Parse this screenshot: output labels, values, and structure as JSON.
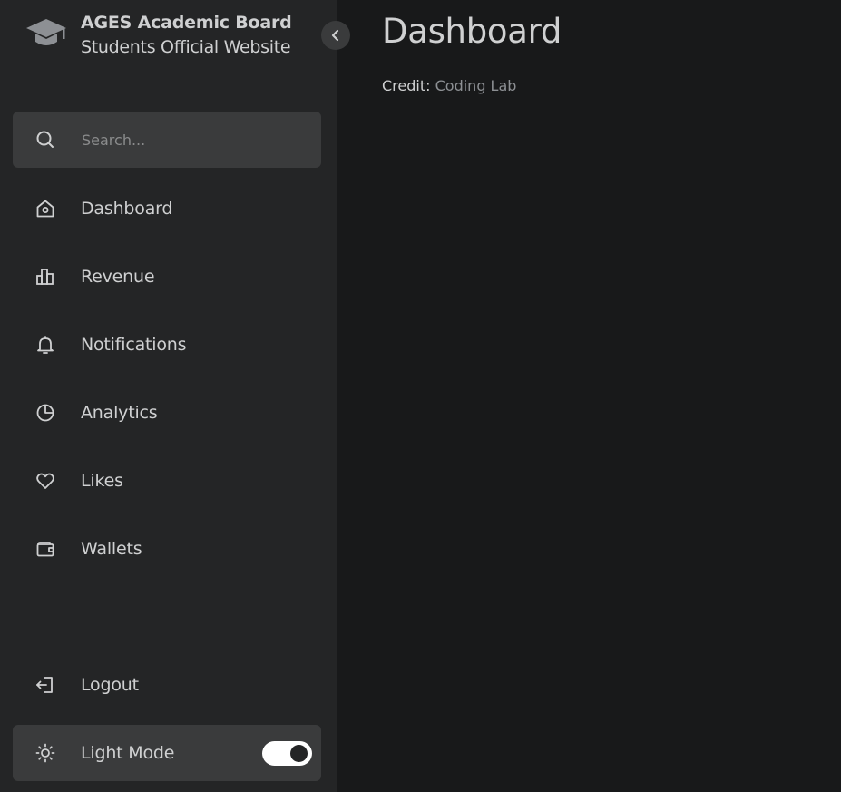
{
  "brand": {
    "name": "AGES Academic Board",
    "subtitle": "Students Official Website"
  },
  "search": {
    "placeholder": "Search...",
    "value": ""
  },
  "nav": {
    "items": [
      {
        "label": "Dashboard",
        "icon": "home-icon"
      },
      {
        "label": "Revenue",
        "icon": "bar-chart-icon"
      },
      {
        "label": "Notifications",
        "icon": "bell-icon"
      },
      {
        "label": "Analytics",
        "icon": "pie-chart-icon"
      },
      {
        "label": "Likes",
        "icon": "heart-icon"
      },
      {
        "label": "Wallets",
        "icon": "wallet-icon"
      }
    ]
  },
  "footer": {
    "logout_label": "Logout",
    "mode_label": "Light Mode"
  },
  "main": {
    "title": "Dashboard",
    "credit_label": "Credit:",
    "credit_link": "Coding Lab"
  },
  "colors": {
    "sidebar_bg": "#242526",
    "body_bg": "#18191a",
    "hover_bg": "#3a3b3c",
    "text": "#cfd0d1",
    "muted": "#8d9094",
    "switch": "#ffffff"
  }
}
